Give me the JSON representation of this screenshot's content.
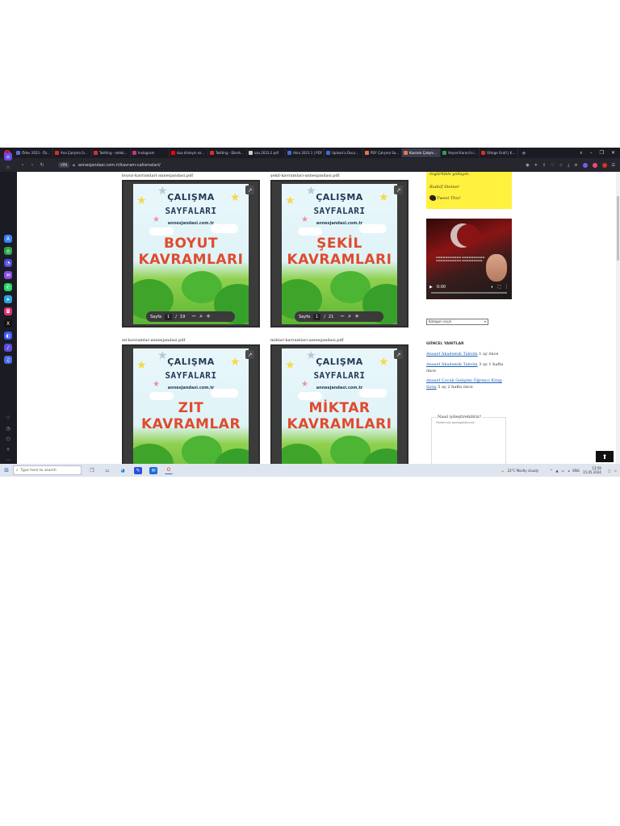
{
  "browser": {
    "tabs": [
      {
        "title": "Ödev 2023 - Öz...",
        "color": "#5b6cd8"
      },
      {
        "title": "Ana Çalışma Sın...",
        "color": "#d93025"
      },
      {
        "title": "Twitting - edebi...",
        "color": "#d93025"
      },
      {
        "title": "Instagram",
        "color": "#c13584"
      },
      {
        "title": "dua dinleyin ezo...",
        "color": "#ff0000"
      },
      {
        "title": "Twitting - Ebrahi...",
        "color": "#d93025"
      },
      {
        "title": "ozu.2023.2.pdf",
        "color": "#cfcfcf"
      },
      {
        "title": "Akro 2023 1 | PDF",
        "color": "#3d6ad6"
      },
      {
        "title": "Upload a Docum...",
        "color": "#3d6ad6"
      },
      {
        "title": "PDF Çalışma Sa...",
        "color": "#e8734a"
      },
      {
        "title": "Kavram Çalışmaları - anne...",
        "color": "#e8734a",
        "active": true
      },
      {
        "title": "Veysel Karani'nin...",
        "color": "#2ca24a"
      },
      {
        "title": "Ottoge Grafi | Ko...",
        "color": "#d93025"
      }
    ],
    "url": "annesjandasi.com.tr/kavram-calismalari/",
    "vpn_label": "VPN"
  },
  "content": {
    "pdfs": [
      {
        "filename": "boyut-kavramlari-annesjandasi.pdf",
        "kind": "BOYUT",
        "second": "KAVRAMLARI",
        "page": "1",
        "total": "19"
      },
      {
        "filename": "şekil-kavramları-annesjandasi.pdf",
        "kind": "ŞEKİL",
        "second": "KAVRAMLARI",
        "page": "1",
        "total": "21"
      },
      {
        "filename": "zıt-kavramlar-annesjandasi.pdf",
        "kind": "ZIT",
        "second": "KAVRAMLAR",
        "page": "",
        "total": ""
      },
      {
        "filename": "miktar-kavramları-annesjandasi.pdf",
        "kind": "MİKTAR",
        "second": "KAVRAMLARI",
        "page": "",
        "total": ""
      }
    ],
    "poster_title1": "ÇALIŞMA",
    "poster_title2": "SAYFALARI",
    "poster_site": "annesjandasi.com.tr",
    "page_label": "Sayfa"
  },
  "sidebar_right": {
    "quote_line1": "özgürlükle yollayın.",
    "quote_author": "Rudolf Steiner",
    "tweet_label": "Tweet This!",
    "video_time": "0:00",
    "category_select": "Kategori seçin",
    "recent_comments_title": "GÜNCEL YANITLAR",
    "comments": [
      {
        "author": "Anasef Akademik Takvim",
        "ago": "1 ay önce"
      },
      {
        "author": "Anasef Akademik Takvim",
        "ago": "3 ay 1 hafta önce"
      },
      {
        "author": "Anasef Çocuk Gelişimi Öğrenci Kitap Satış",
        "ago": "5 ay 2 hafta önce"
      }
    ],
    "form_title": "Nasıl iyileştirebiliriz?",
    "form_placeholder": "Fikirlerinizi paylaşabilirsiniz"
  },
  "taskbar": {
    "search_placeholder": "Type here to search",
    "weather": "23°C  Mostly cloudy",
    "language": "ENG",
    "time": "13:59",
    "date": "15.05.2024"
  }
}
